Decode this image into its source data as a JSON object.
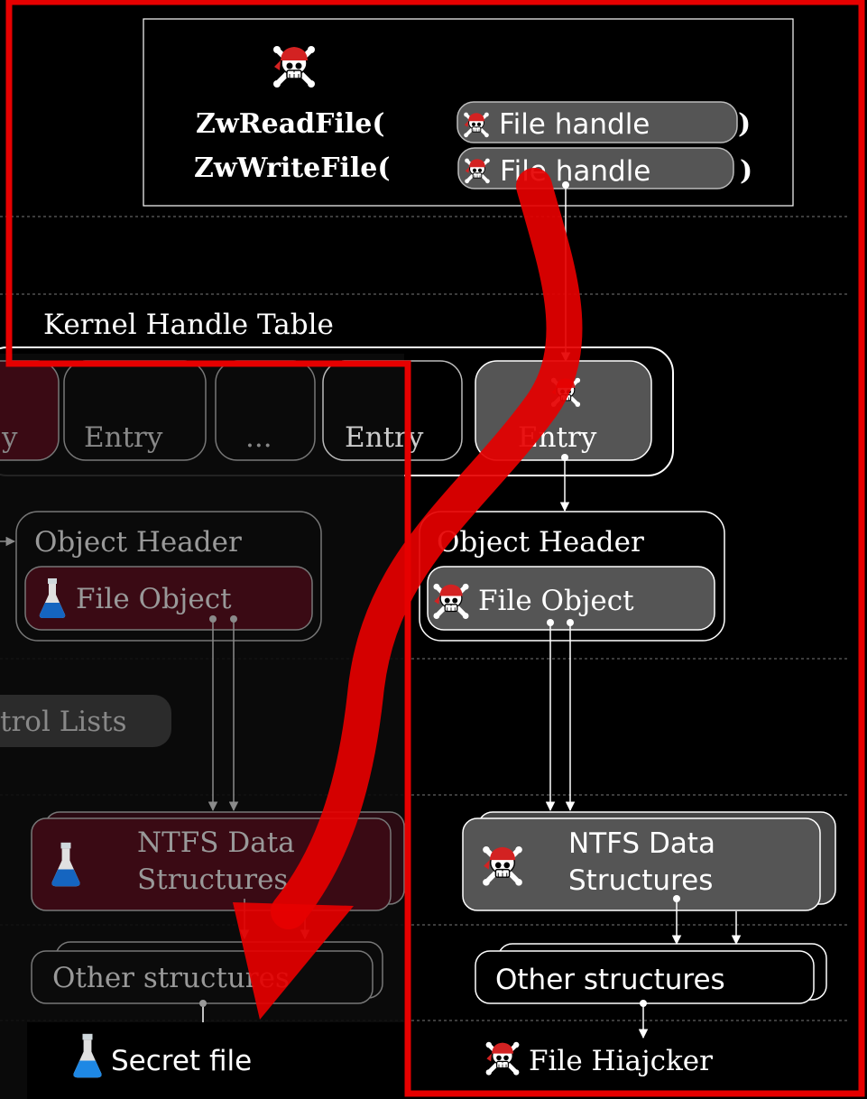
{
  "api_calls": {
    "read_func": "ZwReadFile(",
    "write_func": "ZwWriteFile(",
    "handle_label": "File handle",
    "close_paren": ")"
  },
  "handle_table": {
    "title": "Kernel Handle Table",
    "entries": [
      "y",
      "Entry",
      "...",
      "Entry",
      "Entry"
    ]
  },
  "left_column": {
    "object_header": "Object Header",
    "file_object": "File Object",
    "acl_label": "trol Lists",
    "ntfs_line1": "NTFS Data",
    "ntfs_line2": "Structures",
    "other": "Other structures",
    "result": "Secret file"
  },
  "right_column": {
    "object_header": "Object Header",
    "file_object": "File Object",
    "ntfs_line1": "NTFS Data",
    "ntfs_line2": "Structures",
    "other": "Other structures",
    "result": "File Hiajcker"
  },
  "colors": {
    "highlight": "#e60000",
    "secret_flask": "#1e88e5",
    "dim_fill": "#3a0a14",
    "active_fill": "#555555"
  },
  "icons": [
    "pirate-skull-icon",
    "flask-icon"
  ]
}
